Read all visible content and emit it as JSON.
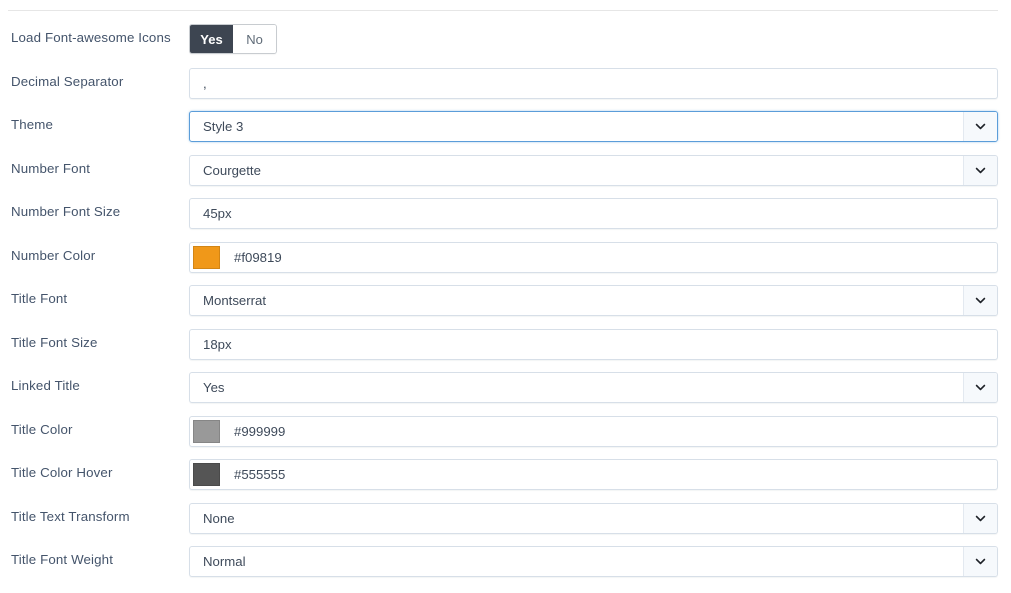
{
  "form": {
    "rows": [
      {
        "label": "Load Font-awesome Icons",
        "type": "toggle",
        "options": [
          "Yes",
          "No"
        ],
        "value": "Yes"
      },
      {
        "label": "Decimal Separator",
        "type": "text",
        "value": ",",
        "placeholder": ""
      },
      {
        "label": "Theme",
        "type": "select",
        "value": "Style 3",
        "focused": true,
        "icon": "chevron-down-icon"
      },
      {
        "label": "Number Font",
        "type": "select",
        "value": "Courgette",
        "focused": false,
        "icon": "chevron-down-icon"
      },
      {
        "label": "Number Font Size",
        "type": "text",
        "value": "45px",
        "placeholder": ""
      },
      {
        "label": "Number Color",
        "type": "color",
        "value": "#f09819",
        "swatch": "#f09819"
      },
      {
        "label": "Title Font",
        "type": "select",
        "value": "Montserrat",
        "focused": false,
        "icon": "chevron-down-icon"
      },
      {
        "label": "Title Font Size",
        "type": "text",
        "value": "18px",
        "placeholder": ""
      },
      {
        "label": "Linked Title",
        "type": "select",
        "value": "Yes",
        "focused": false,
        "icon": "chevron-down-icon"
      },
      {
        "label": "Title Color",
        "type": "color",
        "value": "#999999",
        "swatch": "#999999"
      },
      {
        "label": "Title Color Hover",
        "type": "color",
        "value": "#555555",
        "swatch": "#555555"
      },
      {
        "label": "Title Text Transform",
        "type": "select",
        "value": "None",
        "focused": false,
        "icon": "chevron-down-icon"
      },
      {
        "label": "Title Font Weight",
        "type": "select",
        "value": "Normal",
        "focused": false,
        "icon": "chevron-down-icon"
      }
    ]
  },
  "colors": {
    "label_text": "#44546b",
    "field_text": "#3e4a5a",
    "field_border": "#d7dfe8",
    "focus_border": "#5b9dd9",
    "toggle_active_bg": "#3d4551",
    "divider": "#e6e6e6"
  }
}
